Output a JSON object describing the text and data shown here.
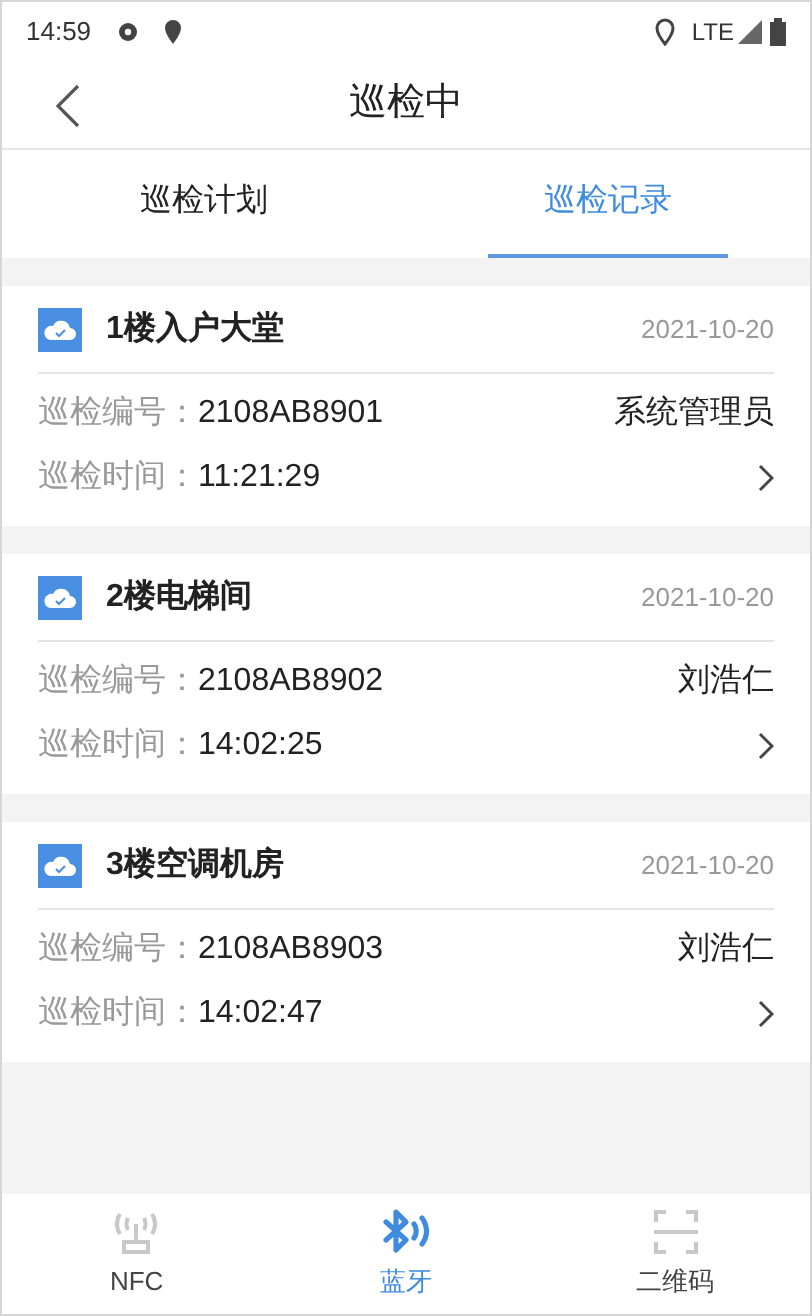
{
  "status_bar": {
    "time": "14:59",
    "network": "LTE"
  },
  "header": {
    "title": "巡检中"
  },
  "tabs": [
    {
      "label": "巡检计划",
      "selected": false
    },
    {
      "label": "巡检记录",
      "selected": true
    }
  ],
  "records": [
    {
      "name": "1楼入户大堂",
      "date": "2021-10-20",
      "number_label": "巡检编号：",
      "number": "2108AB8901",
      "person": "系统管理员",
      "time_label": "巡检时间：",
      "time": "11:21:29"
    },
    {
      "name": "2楼电梯间",
      "date": "2021-10-20",
      "number_label": "巡检编号：",
      "number": "2108AB8902",
      "person": "刘浩仁",
      "time_label": "巡检时间：",
      "time": "14:02:25"
    },
    {
      "name": "3楼空调机房",
      "date": "2021-10-20",
      "number_label": "巡检编号：",
      "number": "2108AB8903",
      "person": "刘浩仁",
      "time_label": "巡检时间：",
      "time": "14:02:47"
    }
  ],
  "bottom_nav": [
    {
      "kind": "nfc",
      "label": "NFC",
      "selected": false
    },
    {
      "kind": "bluetooth",
      "label": "蓝牙",
      "selected": true
    },
    {
      "kind": "qrcode",
      "label": "二维码",
      "selected": false
    }
  ]
}
